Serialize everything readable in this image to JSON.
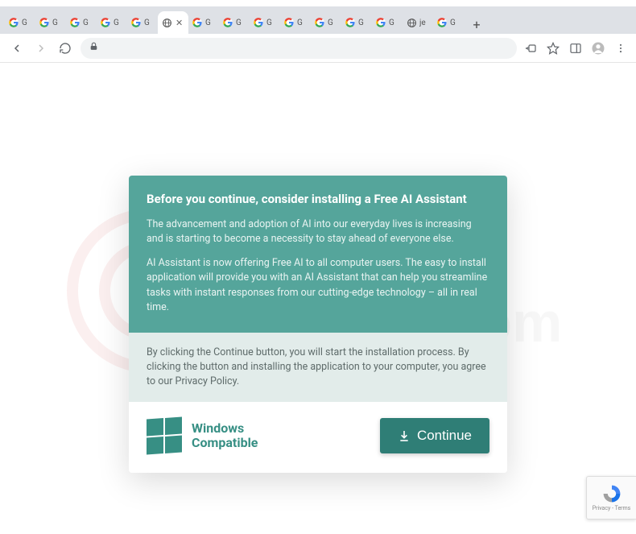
{
  "window": {
    "minimize": "–",
    "maximize": "▢",
    "close": "✕",
    "chevron": "⌄"
  },
  "tabs": {
    "items": [
      {
        "label": "G",
        "type": "google"
      },
      {
        "label": "G",
        "type": "google"
      },
      {
        "label": "G",
        "type": "google"
      },
      {
        "label": "G",
        "type": "google"
      },
      {
        "label": "G",
        "type": "google"
      },
      {
        "label": "",
        "type": "globe",
        "active": true
      },
      {
        "label": "G",
        "type": "google"
      },
      {
        "label": "G",
        "type": "google"
      },
      {
        "label": "G",
        "type": "google"
      },
      {
        "label": "G",
        "type": "google"
      },
      {
        "label": "G",
        "type": "google"
      },
      {
        "label": "G",
        "type": "google"
      },
      {
        "label": "G",
        "type": "google"
      },
      {
        "label": "je",
        "type": "globe"
      },
      {
        "label": "G",
        "type": "google"
      }
    ],
    "newtab": "+"
  },
  "toolbar": {
    "back": "←",
    "forward": "→",
    "reload": "⟳",
    "lock": "lock",
    "share": "share",
    "star": "☆",
    "panel": "▣",
    "profile": "●",
    "menu": "⋮"
  },
  "modal": {
    "heading": "Before you continue, consider installing a Free AI Assistant",
    "para1": "The advancement and adoption of AI into our everyday lives is increasing and is starting to become a necessity to stay ahead of everyone else.",
    "para2": "AI Assistant is now offering Free AI to all computer users. The easy to install application will provide you with an AI Assistant that can help you streamline tasks with instant responses from our cutting-edge technology – all in real time.",
    "midtext": "By clicking the Continue button, you will start the installation process. By clicking the button and installing the application to your computer, you agree to our Privacy Policy.",
    "compat_line1": "Windows",
    "compat_line2": "Compatible",
    "continue_label": "Continue"
  },
  "recaptcha": {
    "line1": "Privacy - Terms"
  },
  "watermark": {
    "text": "pcrisk.com"
  }
}
